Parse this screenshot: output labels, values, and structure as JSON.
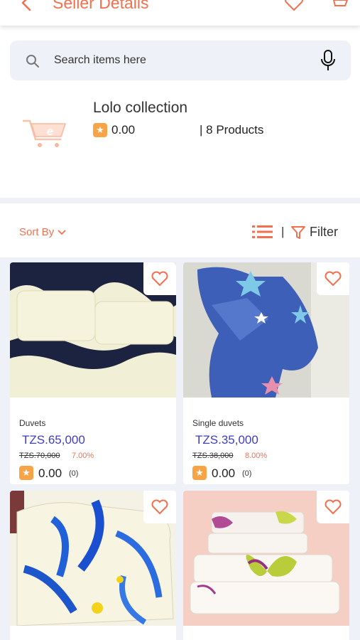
{
  "header": {
    "title": "Seller Details"
  },
  "search": {
    "placeholder": "Search items here"
  },
  "seller": {
    "name": "Lolo collection",
    "rating": "0.00",
    "products": "| 8 Products"
  },
  "sortbar": {
    "sort_label": "Sort By",
    "separator": "|",
    "filter_label": "Filter"
  },
  "colors": {
    "accent": "#f2704f",
    "price": "#3e3ec2",
    "star": "#f7a346",
    "background": "#eef1f7"
  },
  "products": [
    {
      "category": "Duvets",
      "price": "TZS.65,000",
      "old_price": "TZS.70,000",
      "discount": "7.00%",
      "rating": "0.00",
      "reviews": "(0)"
    },
    {
      "category": "Single duvets",
      "price": "TZS.35,000",
      "old_price": "TZS.38,000",
      "discount": "8.00%",
      "rating": "0.00",
      "reviews": "(0)"
    },
    {
      "category": "",
      "price": "",
      "old_price": "",
      "discount": "",
      "rating": "",
      "reviews": ""
    },
    {
      "category": "",
      "price": "",
      "old_price": "",
      "discount": "",
      "rating": "",
      "reviews": ""
    }
  ]
}
